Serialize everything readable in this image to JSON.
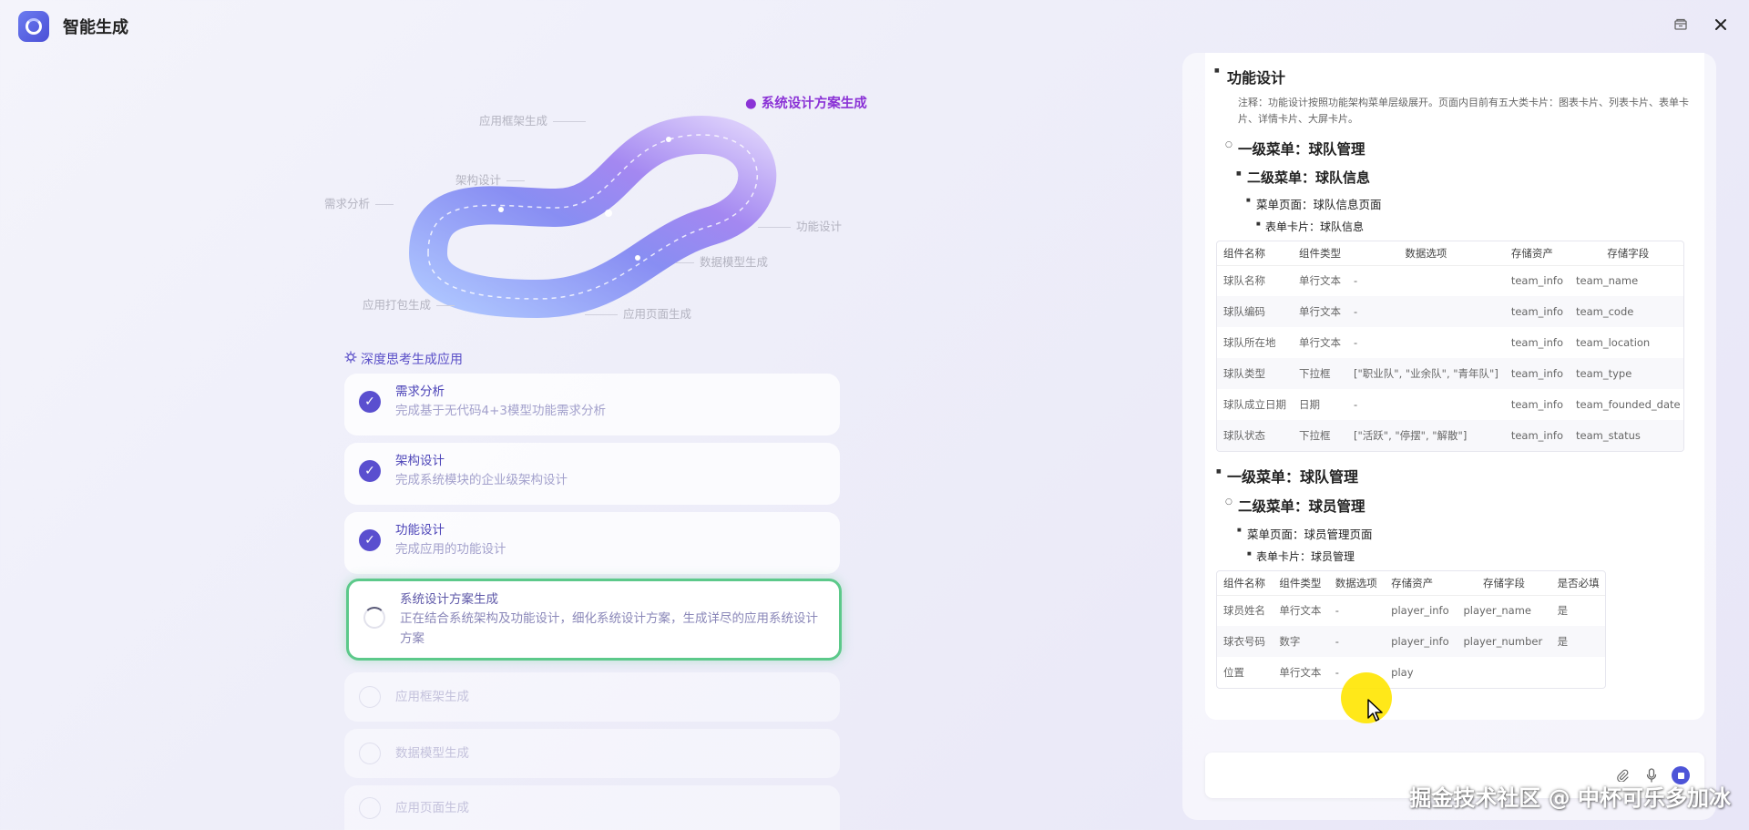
{
  "app": {
    "title": "智能生成"
  },
  "infinity": {
    "labels": {
      "system_design": "系统设计方案生成",
      "app_framework": "应用框架生成",
      "architecture": "架构设计",
      "requirements": "需求分析",
      "function_design": "功能设计",
      "data_model": "数据模型生成",
      "app_packaging": "应用打包生成",
      "app_page": "应用页面生成"
    }
  },
  "steps": {
    "section_title": "深度思考生成应用",
    "items": [
      {
        "title": "需求分析",
        "desc": "完成基于无代码4+3模型功能需求分析",
        "status": "done"
      },
      {
        "title": "架构设计",
        "desc": "完成系统模块的企业级架构设计",
        "status": "done"
      },
      {
        "title": "功能设计",
        "desc": "完成应用的功能设计",
        "status": "done"
      },
      {
        "title": "系统设计方案生成",
        "desc": "正在结合系统架构及功能设计，细化系统设计方案，生成详尽的应用系统设计方案",
        "status": "running"
      },
      {
        "title": "应用框架生成",
        "status": "pending"
      },
      {
        "title": "数据模型生成",
        "status": "pending"
      },
      {
        "title": "应用页面生成",
        "status": "pending"
      }
    ]
  },
  "doc": {
    "heading": "功能设计",
    "note": "注释：功能设计按照功能架构菜单层级展开。页面内目前有五大类卡片：图表卡片、列表卡片、表单卡片、详情卡片、大屏卡片。",
    "menu1": "一级菜单：球队管理",
    "submenu1": "二级菜单：球队信息",
    "page1": "菜单页面：球队信息页面",
    "card1": "表单卡片：球队信息",
    "table1": {
      "headers": [
        "组件名称",
        "组件类型",
        "数据选项",
        "存储资产",
        "存储字段"
      ],
      "rows": [
        [
          "球队名称",
          "单行文本",
          "-",
          "team_info",
          "team_name"
        ],
        [
          "球队编码",
          "单行文本",
          "-",
          "team_info",
          "team_code"
        ],
        [
          "球队所在地",
          "单行文本",
          "-",
          "team_info",
          "team_location"
        ],
        [
          "球队类型",
          "下拉框",
          "[\"职业队\", \"业余队\", \"青年队\"]",
          "team_info",
          "team_type"
        ],
        [
          "球队成立日期",
          "日期",
          "-",
          "team_info",
          "team_founded_date"
        ],
        [
          "球队状态",
          "下拉框",
          "[\"活跃\", \"停摆\", \"解散\"]",
          "team_info",
          "team_status"
        ]
      ]
    },
    "menu2": "一级菜单：球队管理",
    "submenu2": "二级菜单：球员管理",
    "page2": "菜单页面：球员管理页面",
    "card2": "表单卡片：球员管理",
    "table2": {
      "headers": [
        "组件名称",
        "组件类型",
        "数据选项",
        "存储资产",
        "存储字段",
        "是否必填"
      ],
      "rows": [
        [
          "球员姓名",
          "单行文本",
          "-",
          "player_info",
          "player_name",
          "是"
        ],
        [
          "球衣号码",
          "数字",
          "-",
          "player_info",
          "player_number",
          "是"
        ],
        [
          "位置",
          "单行文本",
          "-",
          "play",
          "",
          ""
        ]
      ]
    }
  },
  "input": {
    "placeholder": ""
  },
  "watermark": "掘金技术社区 @ 中杯可乐多加冰",
  "colors": {
    "accent": "#5a4fcf",
    "running_border": "#5cc98a",
    "active_label": "#8b33d6"
  }
}
